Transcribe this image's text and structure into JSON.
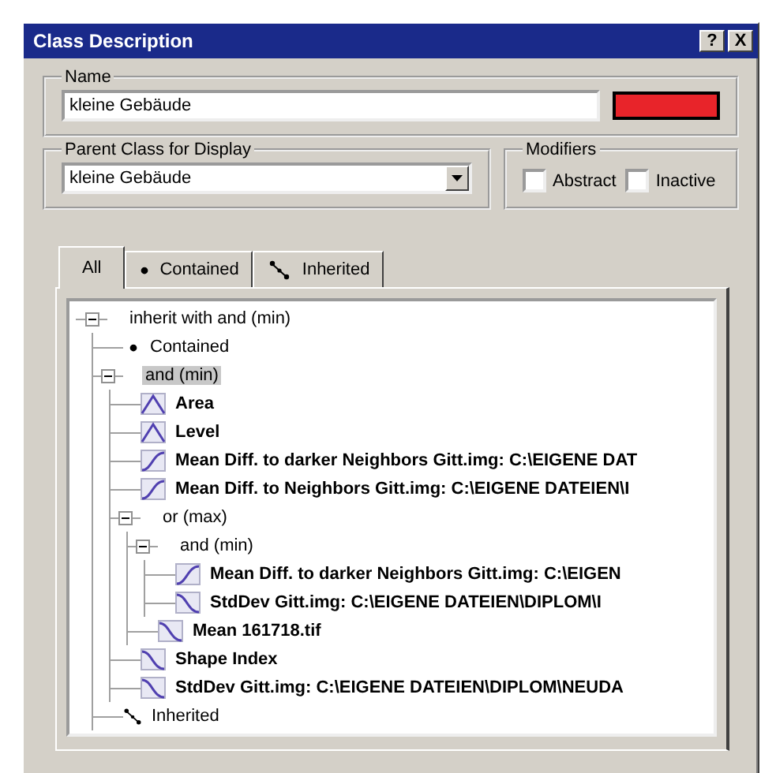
{
  "window": {
    "title": "Class Description",
    "help_button": "?",
    "close_button": "X"
  },
  "name": {
    "label": "Name",
    "value": "kleine Gebäude"
  },
  "parent_class": {
    "label": "Parent Class for Display",
    "value": "kleine Gebäude"
  },
  "modifiers": {
    "label": "Modifiers",
    "options": [
      {
        "label": "Abstract",
        "checked": false
      },
      {
        "label": "Inactive",
        "checked": false
      }
    ]
  },
  "tabs": [
    {
      "label": "All",
      "kind": "all",
      "selected": true
    },
    {
      "label": "Contained",
      "kind": "contained",
      "selected": false
    },
    {
      "label": "Inherited",
      "kind": "inherited",
      "selected": false
    }
  ],
  "tree": [
    {
      "label": "inherit with and (min)",
      "kind": "operator",
      "expanded": true,
      "selected": false,
      "children": [
        {
          "label": "Contained",
          "kind": "contained",
          "selected": false
        },
        {
          "label": "and (min)",
          "kind": "operator",
          "expanded": true,
          "selected": true,
          "children": [
            {
              "label": "Area",
              "kind": "membership",
              "selected": false
            },
            {
              "label": "Level",
              "kind": "membership",
              "selected": false
            },
            {
              "label": "Mean Diff. to darker Neighbors Gitt.img:  C:\\EIGENE DAT",
              "kind": "rising",
              "selected": false
            },
            {
              "label": "Mean Diff. to Neighbors Gitt.img:  C:\\EIGENE DATEIEN\\I",
              "kind": "rising",
              "selected": false
            },
            {
              "label": "or (max)",
              "kind": "operator",
              "expanded": true,
              "selected": false,
              "children": [
                {
                  "label": "and (min)",
                  "kind": "operator",
                  "expanded": true,
                  "selected": false,
                  "children": [
                    {
                      "label": "Mean Diff. to darker Neighbors Gitt.img:  C:\\EIGEN",
                      "kind": "rising",
                      "selected": false
                    },
                    {
                      "label": "StdDev Gitt.img:  C:\\EIGENE DATEIEN\\DIPLOM\\I",
                      "kind": "falling",
                      "selected": false
                    }
                  ]
                },
                {
                  "label": "Mean 161718.tif",
                  "kind": "falling",
                  "selected": false
                }
              ]
            },
            {
              "label": "Shape Index",
              "kind": "falling",
              "selected": false
            },
            {
              "label": "StdDev Gitt.img:  C:\\EIGENE DATEIEN\\DIPLOM\\NEUDA",
              "kind": "falling",
              "selected": false
            }
          ]
        },
        {
          "label": "Inherited",
          "kind": "inherited",
          "selected": false
        }
      ]
    }
  ]
}
